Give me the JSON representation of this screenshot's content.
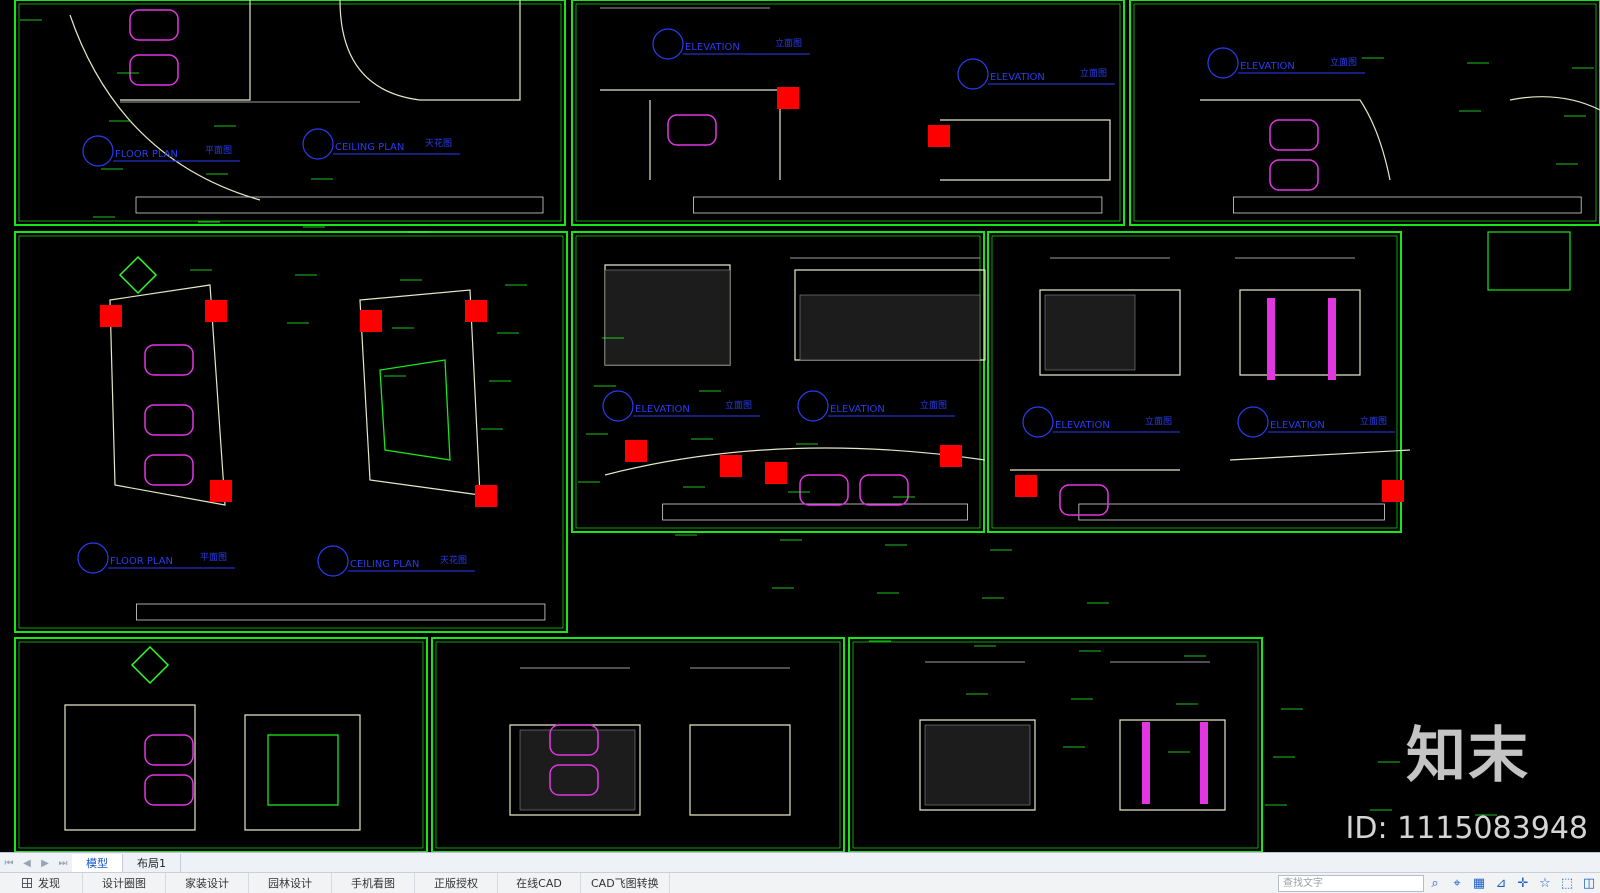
{
  "watermark": {
    "logo": "知末",
    "id": "ID: 1115083948"
  },
  "drawing": {
    "colors": {
      "frame": "#19e619",
      "magenta": "#e236e2",
      "blue": "#2a3cf0",
      "yellow": "#e6e6c8",
      "red": "#ff0000",
      "green_text": "#29ff29"
    },
    "sheet_labels": [
      "FLOOR PLAN",
      "CEILING PLAN",
      "ELEVATION",
      "FLOOR PLAN",
      "CEILING PLAN"
    ],
    "sheet_tags": [
      "平面图",
      "天花图",
      "立面图",
      "平面图",
      "天花图"
    ]
  },
  "layout_tabs": {
    "model": "模型",
    "layout1": "布局1"
  },
  "toolbar": {
    "items": [
      "发现",
      "设计圈图",
      "家装设计",
      "园林设计",
      "手机看图",
      "正版授权",
      "在线CAD",
      "CAD飞图转换"
    ],
    "search_placeholder": "查找文字",
    "icons": [
      "search-icon",
      "snap-icon",
      "grid-icon",
      "ortho-icon",
      "crosshair-icon",
      "star-icon",
      "box-icon",
      "cube-icon"
    ]
  }
}
